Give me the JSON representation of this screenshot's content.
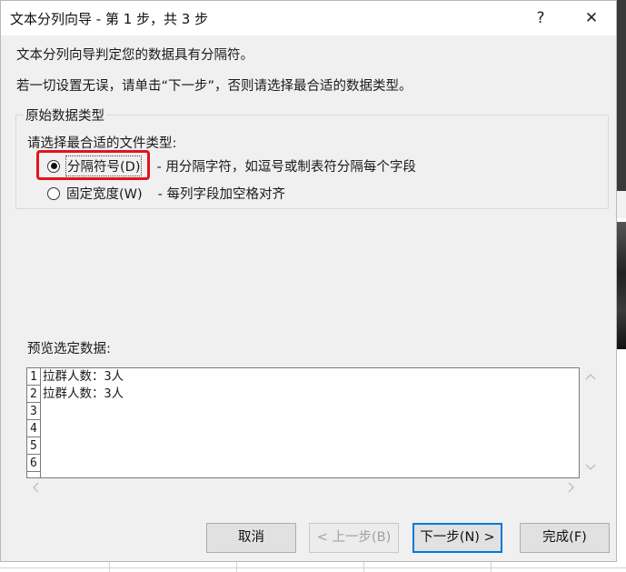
{
  "title": "文本分列向导 - 第 1 步，共 3 步",
  "title_bar": {
    "help": "?",
    "close": "✕"
  },
  "intro": {
    "line1": "文本分列向导判定您的数据具有分隔符。",
    "line2": "若一切设置无误，请单击“下一步”，否则请选择最合适的数据类型。"
  },
  "group": {
    "legend": "原始数据类型",
    "prompt": "请选择最合适的文件类型:",
    "options": [
      {
        "label": "分隔符号(D)",
        "description": "- 用分隔字符，如逗号或制表符分隔每个字段",
        "checked": true
      },
      {
        "label": "固定宽度(W)",
        "description": "- 每列字段加空格对齐",
        "checked": false
      }
    ]
  },
  "preview": {
    "label": "预览选定数据:",
    "line_numbers": [
      "1",
      "2",
      "3",
      "4",
      "5",
      "6"
    ],
    "rows": [
      "拉群人数：3人",
      "拉群人数：3人"
    ]
  },
  "scroll_icons": {
    "up": "chevron-up-icon",
    "down": "chevron-down-icon",
    "left": "chevron-left-icon",
    "right": "chevron-right-icon"
  },
  "buttons": {
    "cancel": "取消",
    "back": "< 上一步(B)",
    "next": "下一步(N) >",
    "finish": "完成(F)"
  },
  "colors": {
    "highlight": "#e0151b",
    "primary_border": "#0078d7",
    "dialog_bg": "#f0f0f0"
  }
}
